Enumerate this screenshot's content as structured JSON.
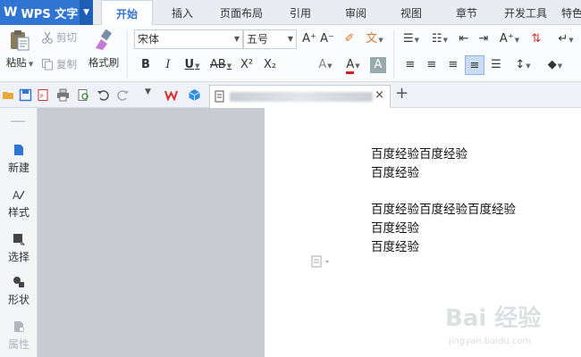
{
  "app": {
    "logo": "W",
    "name": "WPS 文字",
    "caret": "▼"
  },
  "tabs": [
    {
      "label": "开始",
      "active": true
    },
    {
      "label": "插入"
    },
    {
      "label": "页面布局"
    },
    {
      "label": "引用"
    },
    {
      "label": "审阅"
    },
    {
      "label": "视图"
    },
    {
      "label": "章节"
    },
    {
      "label": "开发工具"
    },
    {
      "label": "特色"
    }
  ],
  "ribbon": {
    "paste": "粘贴",
    "cut": "剪切",
    "copy": "复制",
    "format_painter": "格式刷",
    "font_name": "宋体",
    "font_size": "五号"
  },
  "doc_tab": {
    "close": "×",
    "add": "+"
  },
  "pane": {
    "items": [
      {
        "label": "新建"
      },
      {
        "label": "样式"
      },
      {
        "label": "选择"
      },
      {
        "label": "形状"
      },
      {
        "label": "属性"
      }
    ]
  },
  "document": {
    "lines": [
      "百度经验百度经验",
      "百度经验",
      "百度经验百度经验百度经验",
      "百度经验",
      "百度经验"
    ]
  },
  "watermark": {
    "main": "Bai 经验",
    "sub": "jingyan.baidu.com"
  },
  "colors": {
    "accent": "#2f75d1",
    "canvas": "#c8cbd2"
  }
}
